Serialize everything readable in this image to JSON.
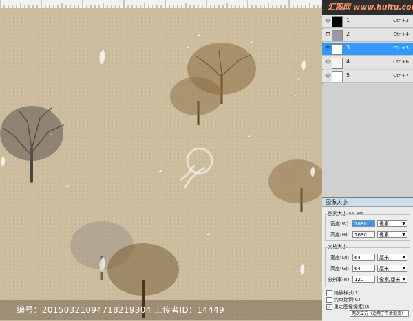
{
  "brand": "汇图网 www.huitu.com",
  "layers": [
    {
      "name": "1",
      "shortcut": "Ctrl+3",
      "thumb": "#000000",
      "selected": false
    },
    {
      "name": "2",
      "shortcut": "Ctrl+4",
      "thumb": "#9a9a9a",
      "selected": false
    },
    {
      "name": "3",
      "shortcut": "Ctrl+5",
      "thumb": "#ffffff",
      "selected": true
    },
    {
      "name": "4",
      "shortcut": "Ctrl+6",
      "thumb": "#f4f4f4",
      "selected": false
    },
    {
      "name": "5",
      "shortcut": "Ctrl+7",
      "thumb": "#ffffff",
      "selected": false
    }
  ],
  "dialog": {
    "title": "图像大小",
    "pixel_dimensions_label": "像素大小:56.3M",
    "pixel": {
      "width_label": "宽度(W):",
      "width_value": "7680",
      "width_unit": "像素",
      "height_label": "高度(H):",
      "height_value": "7680",
      "height_unit": "像素"
    },
    "doc_size_label": "文档大小:",
    "doc": {
      "width_label": "宽度(D):",
      "width_value": "64",
      "width_unit": "厘米",
      "height_label": "高度(G):",
      "height_value": "64",
      "height_unit": "厘米",
      "resolution_label": "分辨率(R):",
      "resolution_value": "120",
      "resolution_unit": "像素/厘米"
    },
    "scale_styles_label": "缩放样式(Y)",
    "constrain_label": "约束比例(C)",
    "resample_label": "重定图像像素(I):",
    "resample_method": "两次立方（适用于平滑渐变）",
    "scale_styles_checked": false,
    "constrain_checked": false,
    "resample_checked": true
  },
  "footer": {
    "text": "编号：20150321094718219304 上传者ID：14449"
  },
  "colors": {
    "background": "#cdbd9f",
    "selected_layer": "#3399ff",
    "brand_text": "#ff9a6a"
  }
}
